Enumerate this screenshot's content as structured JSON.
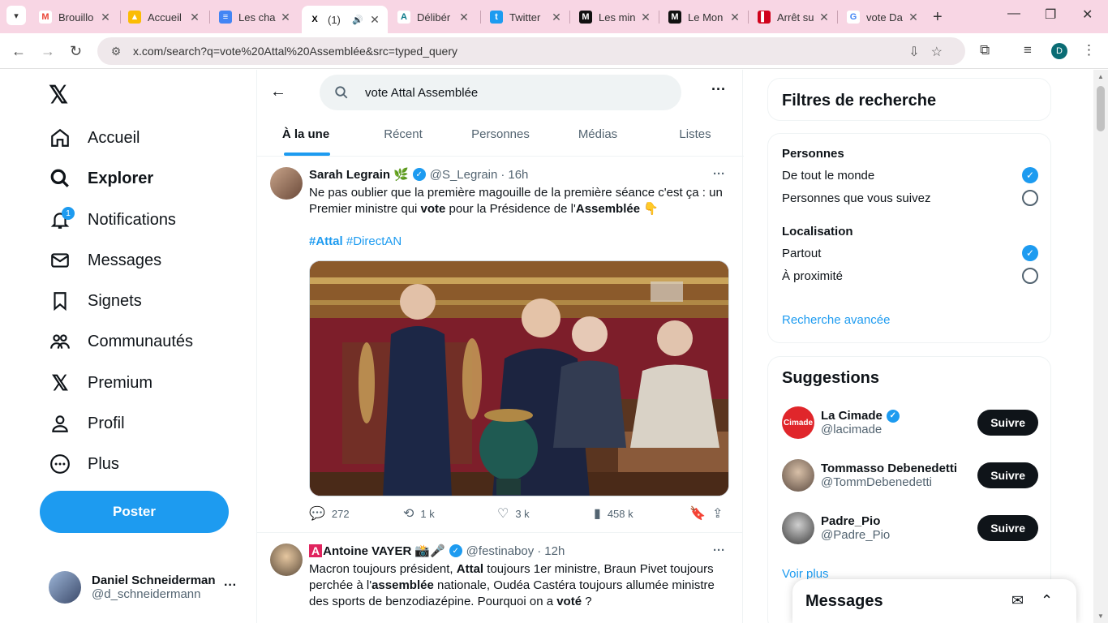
{
  "browser": {
    "tabs": [
      {
        "title": "Brouillo",
        "favicon": "M",
        "color": "#ea4335"
      },
      {
        "title": "Accueil",
        "favicon": "▲",
        "color": "#34a853"
      },
      {
        "title": "Les cha",
        "favicon": "≡",
        "color": "#4285f4"
      },
      {
        "title": "(1) ",
        "favicon": "X",
        "color": "#000000",
        "active": true
      },
      {
        "title": "Délibér",
        "favicon": "A",
        "color": "#0b7a8a"
      },
      {
        "title": "Twitter",
        "favicon": "t",
        "color": "#1d9bf0"
      },
      {
        "title": "Les min",
        "favicon": "M",
        "color": "#111111"
      },
      {
        "title": "Le Mon",
        "favicon": "M",
        "color": "#111111"
      },
      {
        "title": "Arrêt su",
        "favicon": "▌",
        "color": "#d0021b"
      },
      {
        "title": "vote Da",
        "favicon": "G",
        "color": "#4285f4"
      }
    ],
    "url": "x.com/search?q=vote%20Attal%20Assemblée&src=typed_query",
    "profile_initial": "D"
  },
  "sidebar": {
    "items": [
      {
        "label": "Accueil",
        "icon": "home-icon"
      },
      {
        "label": "Explorer",
        "icon": "search-icon"
      },
      {
        "label": "Notifications",
        "icon": "bell-icon",
        "badge": "1"
      },
      {
        "label": "Messages",
        "icon": "mail-icon"
      },
      {
        "label": "Signets",
        "icon": "bookmark-icon"
      },
      {
        "label": "Communautés",
        "icon": "communities-icon"
      },
      {
        "label": "Premium",
        "icon": "x-logo-icon"
      },
      {
        "label": "Profil",
        "icon": "person-icon"
      },
      {
        "label": "Plus",
        "icon": "more-circle-icon"
      }
    ],
    "post_label": "Poster",
    "account": {
      "name": "Daniel Schneiderman",
      "handle": "@d_schneidermann"
    }
  },
  "search": {
    "query": "vote Attal Assemblée",
    "tabs": [
      "À la une",
      "Récent",
      "Personnes",
      "Médias",
      "Listes"
    ]
  },
  "tweets": [
    {
      "name": "Sarah Legrain",
      "emoji": "🌿",
      "handle": "@S_Legrain",
      "time": "16h",
      "text_parts": [
        "Ne pas oublier que la première magouille de la première séance c'est ça : un Premier ministre qui ",
        "vote",
        " pour la Présidence de l'",
        "Assemblée",
        " 👇"
      ],
      "hashtags": [
        "#Attal",
        "#DirectAN"
      ],
      "replies": "272",
      "reposts": "1 k",
      "likes": "3 k",
      "views": "458 k"
    },
    {
      "name": "Antoine VAYER",
      "emoji": "📸🎤",
      "handle": "@festinaboy",
      "time": "12h",
      "text_parts": [
        "Macron toujours président, ",
        "Attal",
        " toujours 1er ministre, Braun Pivet toujours perchée à l'",
        "assemblée",
        " nationale, Oudéa Castéra toujours allumée ministre des sports de benzodiazépine. Pourquoi on a ",
        "voté",
        " ?"
      ]
    }
  ],
  "filters": {
    "title": "Filtres de recherche",
    "people_title": "Personnes",
    "people_options": [
      "De tout le monde",
      "Personnes que vous suivez"
    ],
    "location_title": "Localisation",
    "location_options": [
      "Partout",
      "À proximité"
    ],
    "advanced_link": "Recherche avancée"
  },
  "suggestions": {
    "title": "Suggestions",
    "users": [
      {
        "name": "La Cimade",
        "handle": "@lacimade",
        "verified": true
      },
      {
        "name": "Tommasso Debenedetti",
        "handle": "@TommDebenedetti"
      },
      {
        "name": "Padre_Pio",
        "handle": "@Padre_Pio"
      }
    ],
    "follow_label": "Suivre",
    "see_more": "Voir plus"
  },
  "messages_drawer": {
    "title": "Messages"
  },
  "colors": {
    "accent": "#1d9bf0",
    "tabstrip": "#f8d6e4",
    "text": "#0f1419",
    "muted": "#536471"
  }
}
